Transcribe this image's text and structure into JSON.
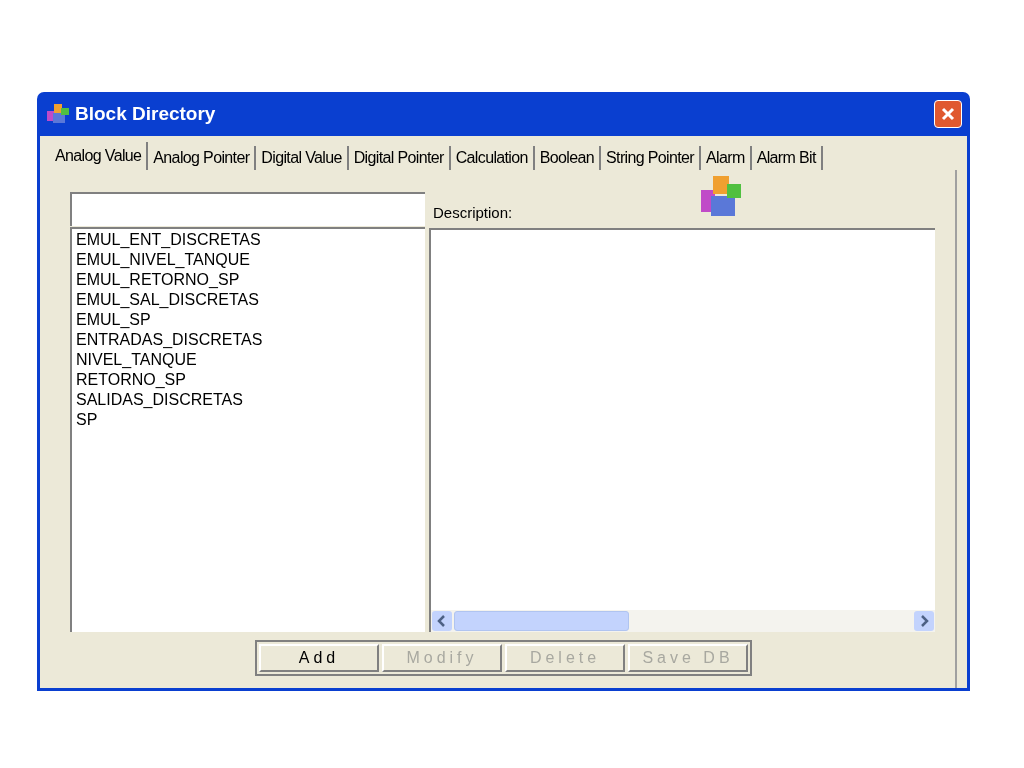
{
  "window": {
    "title": "Block Directory"
  },
  "tabs": [
    {
      "label": "Analog Value",
      "selected": true
    },
    {
      "label": "Analog Pointer",
      "selected": false
    },
    {
      "label": "Digital Value",
      "selected": false
    },
    {
      "label": "Digital Pointer",
      "selected": false
    },
    {
      "label": "Calculation",
      "selected": false
    },
    {
      "label": "Boolean",
      "selected": false
    },
    {
      "label": "String Pointer",
      "selected": false
    },
    {
      "label": "Alarm",
      "selected": false
    },
    {
      "label": "Alarm Bit",
      "selected": false
    }
  ],
  "blocks": [
    "EMUL_ENT_DISCRETAS",
    "EMUL_NIVEL_TANQUE",
    "EMUL_RETORNO_SP",
    "EMUL_SAL_DISCRETAS",
    "EMUL_SP",
    "ENTRADAS_DISCRETAS",
    "NIVEL_TANQUE",
    "RETORNO_SP",
    "SALIDAS_DISCRETAS",
    "SP"
  ],
  "description_label": "Description:",
  "buttons": [
    {
      "label": "Add",
      "disabled": false
    },
    {
      "label": "Modify",
      "disabled": true
    },
    {
      "label": "Delete",
      "disabled": true
    },
    {
      "label": "Save DB",
      "disabled": true
    }
  ]
}
